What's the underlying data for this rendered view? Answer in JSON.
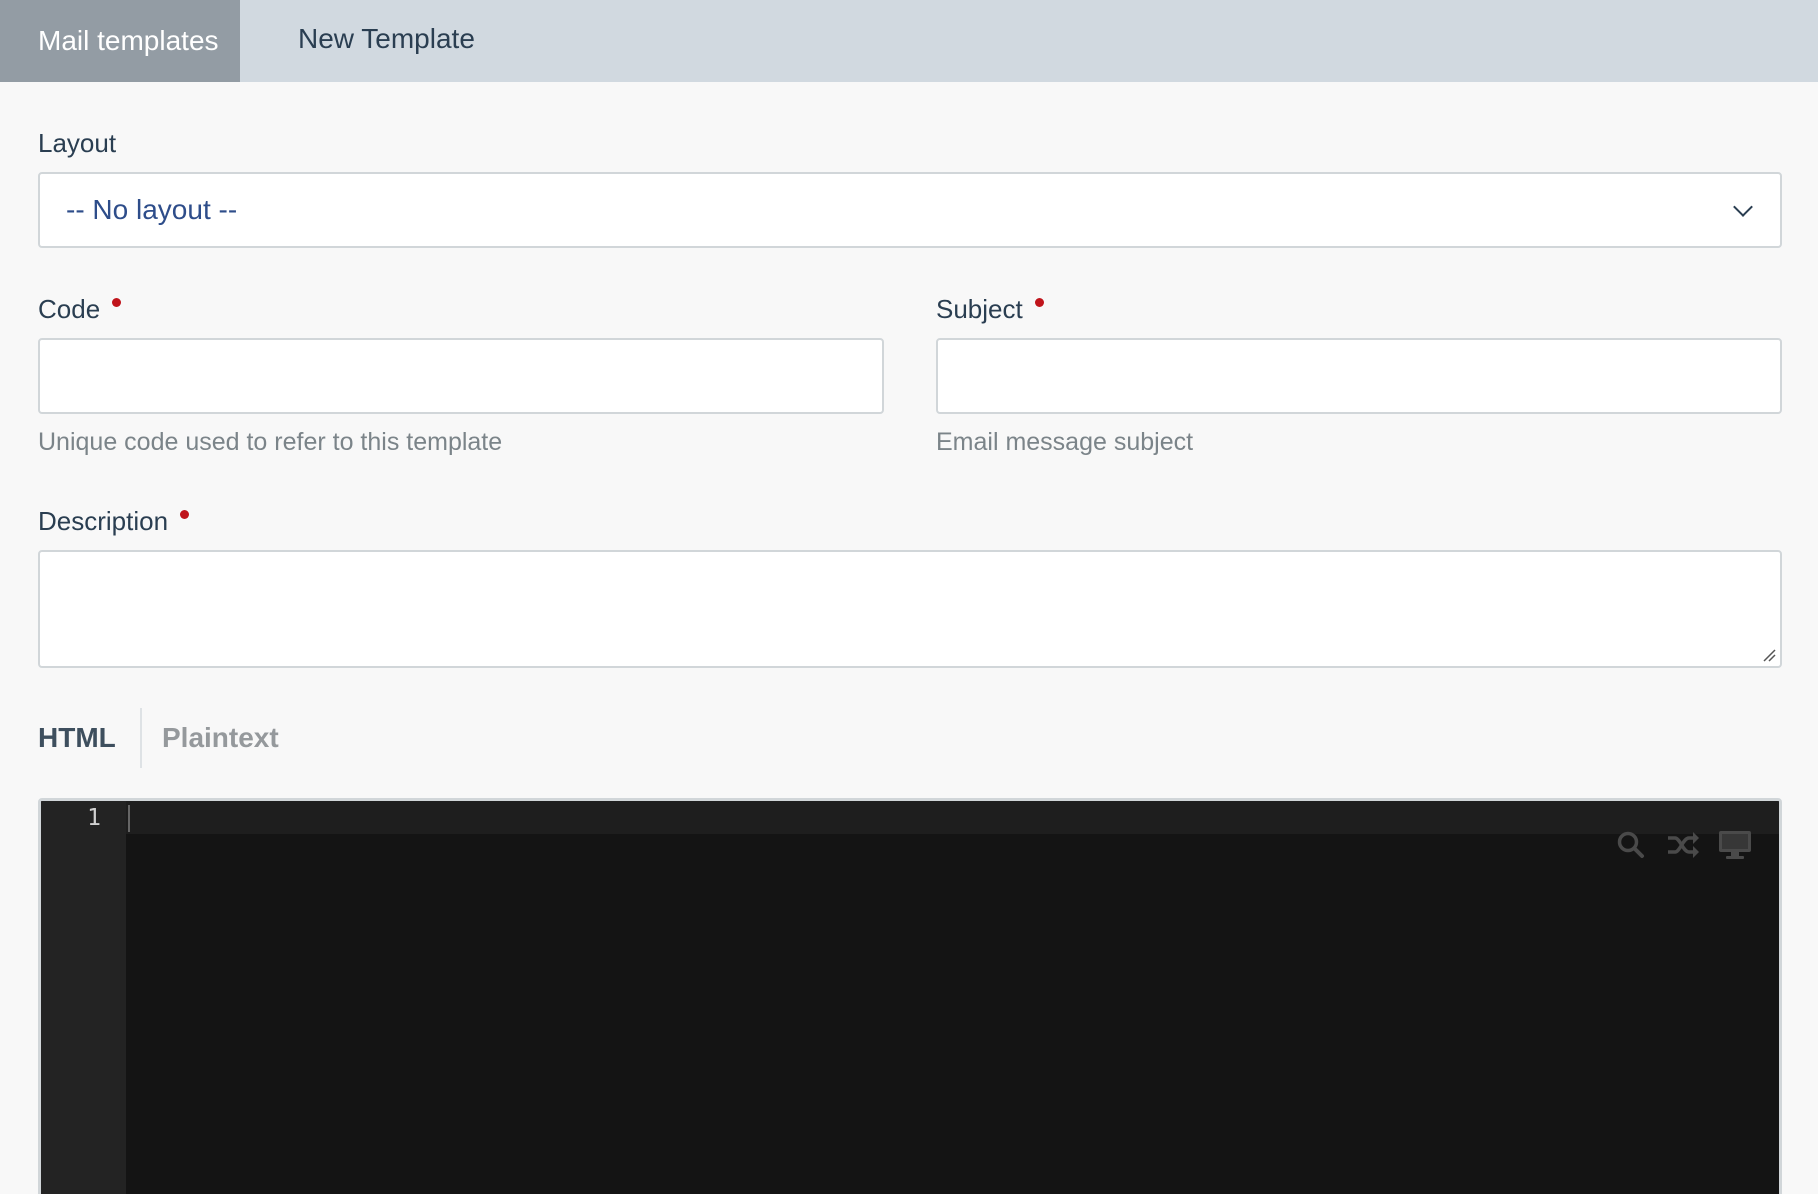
{
  "breadcrumb": {
    "parent": "Mail templates",
    "current": "New Template"
  },
  "form": {
    "layout": {
      "label": "Layout",
      "selected": "-- No layout --"
    },
    "code": {
      "label": "Code",
      "value": "",
      "help": "Unique code used to refer to this template"
    },
    "subject": {
      "label": "Subject",
      "value": "",
      "help": "Email message subject"
    },
    "description": {
      "label": "Description",
      "value": ""
    }
  },
  "tabs": [
    {
      "label": "HTML",
      "active": true
    },
    {
      "label": "Plaintext",
      "active": false
    }
  ],
  "editor": {
    "line_numbers": [
      "1"
    ],
    "toolbar_icons": [
      "search-icon",
      "shuffle-icon",
      "desktop-icon"
    ]
  },
  "colors": {
    "required": "#c0141b",
    "breadcrumb_parent_bg": "#939ca4",
    "breadcrumb_bar_bg": "#d1d9e0",
    "editor_bg": "#141414"
  }
}
